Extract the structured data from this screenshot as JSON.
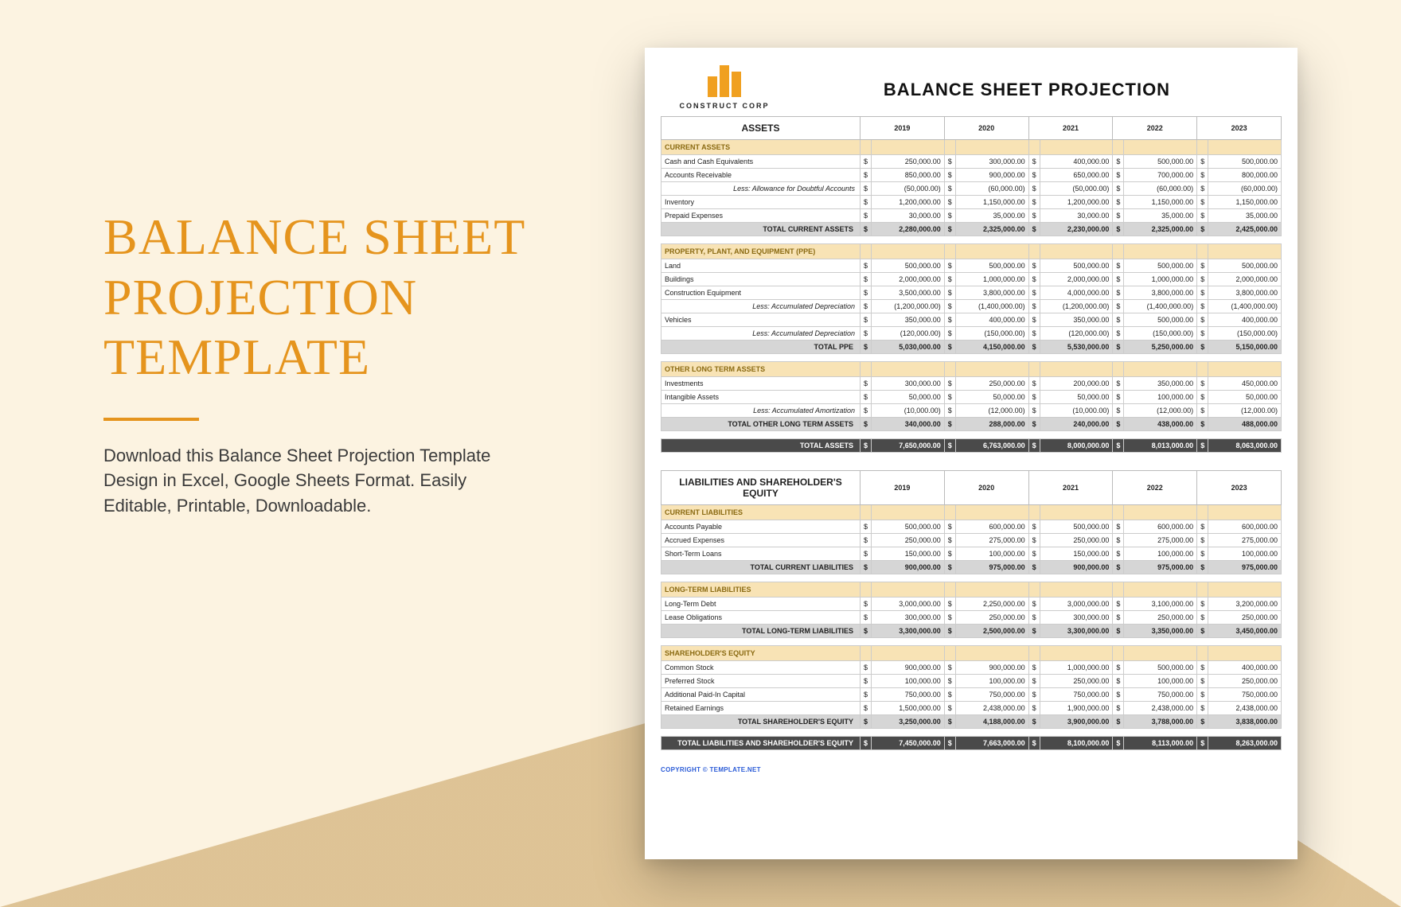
{
  "promo": {
    "title_l1": "BALANCE SHEET",
    "title_l2": "PROJECTION",
    "title_l3": "TEMPLATE",
    "blurb": "Download this Balance Sheet Projection Template Design in Excel, Google Sheets Format. Easily Editable, Printable, Downloadable."
  },
  "doc": {
    "company": "CONSTRUCT CORP",
    "title": "BALANCE SHEET PROJECTION",
    "copyright": "COPYRIGHT © TEMPLATE.NET",
    "years": [
      "2019",
      "2020",
      "2021",
      "2022",
      "2023"
    ],
    "sections": [
      {
        "header": "ASSETS",
        "groups": [
          {
            "cat": "CURRENT ASSETS",
            "rows": [
              {
                "l": "Cash and Cash Equivalents",
                "v": [
                  "250,000.00",
                  "300,000.00",
                  "400,000.00",
                  "500,000.00",
                  "500,000.00"
                ]
              },
              {
                "l": "Accounts Receivable",
                "v": [
                  "850,000.00",
                  "900,000.00",
                  "650,000.00",
                  "700,000.00",
                  "800,000.00"
                ]
              },
              {
                "l": "Less: Allowance for Doubtful Accounts",
                "indent": true,
                "v": [
                  "(50,000.00)",
                  "(60,000.00)",
                  "(50,000.00)",
                  "(60,000.00)",
                  "(60,000.00)"
                ]
              },
              {
                "l": "Inventory",
                "v": [
                  "1,200,000.00",
                  "1,150,000.00",
                  "1,200,000.00",
                  "1,150,000.00",
                  "1,150,000.00"
                ]
              },
              {
                "l": "Prepaid Expenses",
                "v": [
                  "30,000.00",
                  "35,000.00",
                  "30,000.00",
                  "35,000.00",
                  "35,000.00"
                ]
              }
            ],
            "total": {
              "l": "TOTAL CURRENT ASSETS",
              "v": [
                "2,280,000.00",
                "2,325,000.00",
                "2,230,000.00",
                "2,325,000.00",
                "2,425,000.00"
              ]
            }
          },
          {
            "cat": "PROPERTY, PLANT, AND EQUIPMENT (PPE)",
            "rows": [
              {
                "l": "Land",
                "v": [
                  "500,000.00",
                  "500,000.00",
                  "500,000.00",
                  "500,000.00",
                  "500,000.00"
                ]
              },
              {
                "l": "Buildings",
                "v": [
                  "2,000,000.00",
                  "1,000,000.00",
                  "2,000,000.00",
                  "1,000,000.00",
                  "2,000,000.00"
                ]
              },
              {
                "l": "Construction Equipment",
                "v": [
                  "3,500,000.00",
                  "3,800,000.00",
                  "4,000,000.00",
                  "3,800,000.00",
                  "3,800,000.00"
                ]
              },
              {
                "l": "Less: Accumulated Depreciation",
                "indent": true,
                "v": [
                  "(1,200,000.00)",
                  "(1,400,000.00)",
                  "(1,200,000.00)",
                  "(1,400,000.00)",
                  "(1,400,000.00)"
                ]
              },
              {
                "l": "Vehicles",
                "v": [
                  "350,000.00",
                  "400,000.00",
                  "350,000.00",
                  "500,000.00",
                  "400,000.00"
                ]
              },
              {
                "l": "Less: Accumulated Depreciation",
                "indent": true,
                "v": [
                  "(120,000.00)",
                  "(150,000.00)",
                  "(120,000.00)",
                  "(150,000.00)",
                  "(150,000.00)"
                ]
              }
            ],
            "total": {
              "l": "TOTAL PPE",
              "v": [
                "5,030,000.00",
                "4,150,000.00",
                "5,530,000.00",
                "5,250,000.00",
                "5,150,000.00"
              ]
            }
          },
          {
            "cat": "OTHER LONG TERM ASSETS",
            "rows": [
              {
                "l": "Investments",
                "v": [
                  "300,000.00",
                  "250,000.00",
                  "200,000.00",
                  "350,000.00",
                  "450,000.00"
                ]
              },
              {
                "l": "Intangible Assets",
                "v": [
                  "50,000.00",
                  "50,000.00",
                  "50,000.00",
                  "100,000.00",
                  "50,000.00"
                ]
              },
              {
                "l": "Less: Accumulated Amortization",
                "indent": true,
                "v": [
                  "(10,000.00)",
                  "(12,000.00)",
                  "(10,000.00)",
                  "(12,000.00)",
                  "(12,000.00)"
                ]
              }
            ],
            "total": {
              "l": "TOTAL OTHER LONG TERM ASSETS",
              "v": [
                "340,000.00",
                "288,000.00",
                "240,000.00",
                "438,000.00",
                "488,000.00"
              ]
            }
          }
        ],
        "mega": {
          "l": "TOTAL ASSETS",
          "v": [
            "7,650,000.00",
            "6,763,000.00",
            "8,000,000.00",
            "8,013,000.00",
            "8,063,000.00"
          ]
        }
      },
      {
        "header": "LIABILITIES AND SHAREHOLDER'S EQUITY",
        "groups": [
          {
            "cat": "CURRENT LIABILITIES",
            "rows": [
              {
                "l": "Accounts Payable",
                "v": [
                  "500,000.00",
                  "600,000.00",
                  "500,000.00",
                  "600,000.00",
                  "600,000.00"
                ]
              },
              {
                "l": "Accrued Expenses",
                "v": [
                  "250,000.00",
                  "275,000.00",
                  "250,000.00",
                  "275,000.00",
                  "275,000.00"
                ]
              },
              {
                "l": "Short-Term Loans",
                "v": [
                  "150,000.00",
                  "100,000.00",
                  "150,000.00",
                  "100,000.00",
                  "100,000.00"
                ]
              }
            ],
            "total": {
              "l": "TOTAL CURRENT LIABILITIES",
              "v": [
                "900,000.00",
                "975,000.00",
                "900,000.00",
                "975,000.00",
                "975,000.00"
              ]
            }
          },
          {
            "cat": "LONG-TERM LIABILITIES",
            "rows": [
              {
                "l": "Long-Term Debt",
                "v": [
                  "3,000,000.00",
                  "2,250,000.00",
                  "3,000,000.00",
                  "3,100,000.00",
                  "3,200,000.00"
                ]
              },
              {
                "l": "Lease Obligations",
                "v": [
                  "300,000.00",
                  "250,000.00",
                  "300,000.00",
                  "250,000.00",
                  "250,000.00"
                ]
              }
            ],
            "total": {
              "l": "TOTAL LONG-TERM LIABILITIES",
              "v": [
                "3,300,000.00",
                "2,500,000.00",
                "3,300,000.00",
                "3,350,000.00",
                "3,450,000.00"
              ]
            }
          },
          {
            "cat": "SHAREHOLDER'S EQUITY",
            "rows": [
              {
                "l": "Common Stock",
                "v": [
                  "900,000.00",
                  "900,000.00",
                  "1,000,000.00",
                  "500,000.00",
                  "400,000.00"
                ]
              },
              {
                "l": "Preferred Stock",
                "v": [
                  "100,000.00",
                  "100,000.00",
                  "250,000.00",
                  "100,000.00",
                  "250,000.00"
                ]
              },
              {
                "l": "Additional Paid-In Capital",
                "v": [
                  "750,000.00",
                  "750,000.00",
                  "750,000.00",
                  "750,000.00",
                  "750,000.00"
                ]
              },
              {
                "l": "Retained Earnings",
                "v": [
                  "1,500,000.00",
                  "2,438,000.00",
                  "1,900,000.00",
                  "2,438,000.00",
                  "2,438,000.00"
                ]
              }
            ],
            "total": {
              "l": "TOTAL SHAREHOLDER'S EQUITY",
              "v": [
                "3,250,000.00",
                "4,188,000.00",
                "3,900,000.00",
                "3,788,000.00",
                "3,838,000.00"
              ]
            }
          }
        ],
        "mega": {
          "l": "TOTAL LIABILITIES AND SHAREHOLDER'S EQUITY",
          "v": [
            "7,450,000.00",
            "7,663,000.00",
            "8,100,000.00",
            "8,113,000.00",
            "8,263,000.00"
          ]
        }
      }
    ]
  }
}
